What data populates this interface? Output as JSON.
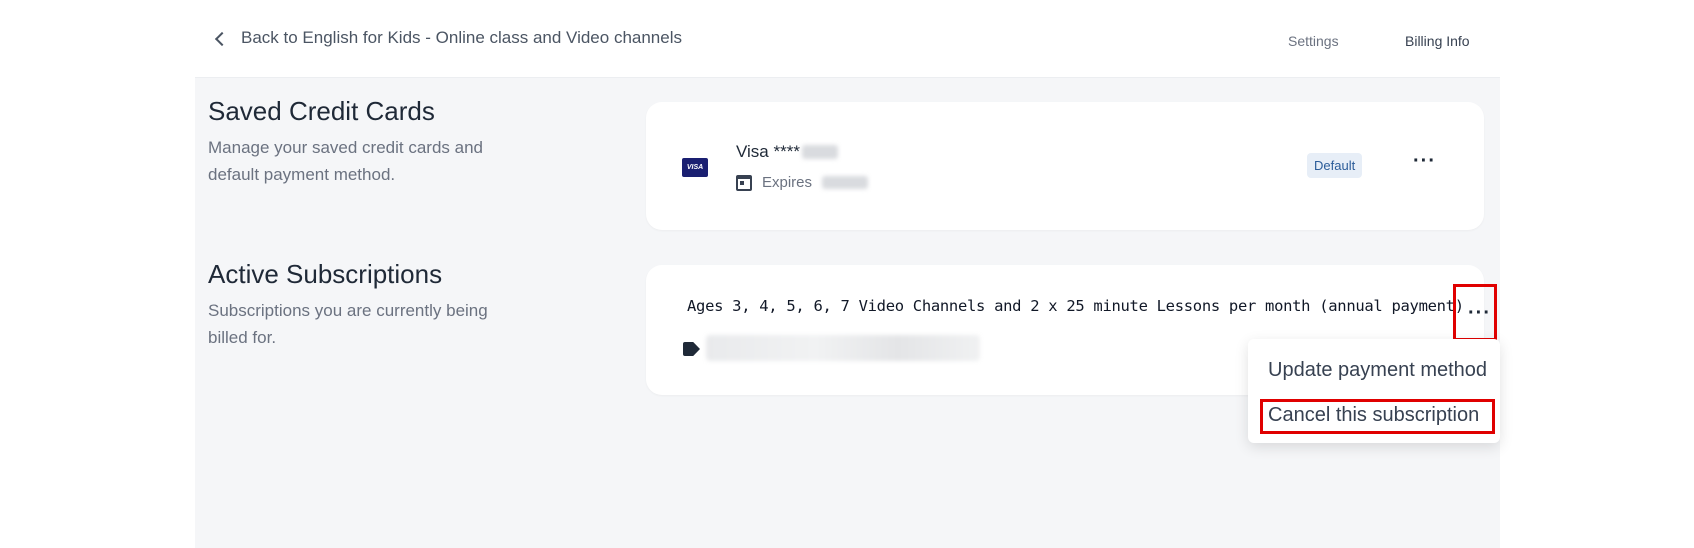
{
  "header": {
    "back_label": "Back to English for Kids - Online class and Video channels",
    "nav": [
      {
        "label": "Settings"
      },
      {
        "label": "Billing Info",
        "active": true
      }
    ]
  },
  "saved_cards": {
    "title": "Saved Credit Cards",
    "description": "Manage your saved credit cards and default payment method.",
    "card": {
      "brand_logo_text": "VISA",
      "name": "Visa ****",
      "expires_label": "Expires",
      "badge": "Default",
      "more_icon": "ellipsis-icon"
    }
  },
  "subscriptions": {
    "title": "Active Subscriptions",
    "description": "Subscriptions you are currently being billed for.",
    "item": {
      "name": "Ages 3, 4, 5, 6, 7  Video Channels and 2 x 25 minute Lessons per month (annual payment)",
      "price_icon": "tag-icon",
      "more_icon": "ellipsis-icon"
    },
    "menu": {
      "items": [
        {
          "label": "Update payment method"
        },
        {
          "label": "Cancel this subscription"
        }
      ]
    }
  },
  "colors": {
    "highlight": "#e00000",
    "badge_bg": "#e7eef7",
    "badge_text": "#2b5c99",
    "visa_blue": "#1a1f71",
    "page_bg": "#f5f6f8"
  }
}
